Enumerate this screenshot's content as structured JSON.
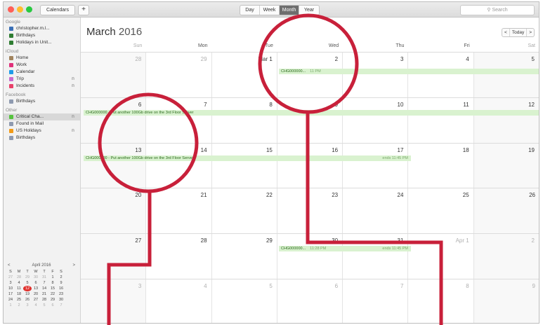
{
  "toolbar": {
    "calendars_btn": "Calendars",
    "add_btn": "+",
    "views": [
      "Day",
      "Week",
      "Month",
      "Year"
    ],
    "selected_view": "Month",
    "search_placeholder": "Search"
  },
  "sidebar": {
    "groups": [
      {
        "name": "Google",
        "items": [
          {
            "label": "christopher.m.l...",
            "color": "#3b6fb6"
          },
          {
            "label": "Birthdays",
            "color": "#2f7d32"
          },
          {
            "label": "Holidays in Unit...",
            "color": "#2f7d32"
          }
        ]
      },
      {
        "name": "iCloud",
        "items": [
          {
            "label": "Home",
            "color": "#a2845e"
          },
          {
            "label": "Work",
            "color": "#e0307a"
          },
          {
            "label": "Calendar",
            "color": "#1e9be8"
          },
          {
            "label": "Trip",
            "color": "#c86bd0"
          },
          {
            "label": "Incidents",
            "color": "#e8416a"
          }
        ]
      },
      {
        "name": "Facebook",
        "items": [
          {
            "label": "Birthdays",
            "color": "#8e9ab0"
          }
        ]
      },
      {
        "name": "Other",
        "items": [
          {
            "label": "Critical Cha...",
            "color": "#56c23e"
          },
          {
            "label": "Found in Mail",
            "color": "#8e9ab0"
          },
          {
            "label": "US Holidays",
            "color": "#f29b18"
          },
          {
            "label": "Birthdays",
            "color": "#8e9ab0"
          }
        ]
      }
    ]
  },
  "mini_cal": {
    "title": "April 2016",
    "prev": "<",
    "next": ">",
    "dow": [
      "S",
      "M",
      "T",
      "W",
      "T",
      "F",
      "S"
    ],
    "weeks": [
      [
        "27",
        "28",
        "29",
        "30",
        "31",
        "1",
        "2"
      ],
      [
        "3",
        "4",
        "5",
        "6",
        "7",
        "8",
        "9"
      ],
      [
        "10",
        "11",
        "12",
        "13",
        "14",
        "15",
        "16"
      ],
      [
        "17",
        "18",
        "19",
        "20",
        "21",
        "22",
        "23"
      ],
      [
        "24",
        "25",
        "26",
        "27",
        "28",
        "29",
        "30"
      ],
      [
        "1",
        "2",
        "3",
        "4",
        "5",
        "6",
        "7"
      ]
    ]
  },
  "main": {
    "month": "March",
    "year": "2016",
    "nav_prev": "<",
    "nav_today": "Today",
    "nav_next": ">",
    "dow": [
      "Sun",
      "Mon",
      "Tue",
      "Wed",
      "Thu",
      "Fri",
      "Sat"
    ],
    "weeks": [
      [
        "28",
        "29",
        "Mar 1",
        "2",
        "3",
        "4",
        "5"
      ],
      [
        "6",
        "7",
        "8",
        "9",
        "10",
        "11",
        "12"
      ],
      [
        "13",
        "14",
        "15",
        "16",
        "17",
        "18",
        "19"
      ],
      [
        "20",
        "21",
        "22",
        "23",
        "24",
        "25",
        "26"
      ],
      [
        "27",
        "28",
        "29",
        "30",
        "31",
        "Apr 1",
        "2"
      ],
      [
        "3",
        "4",
        "5",
        "6",
        "7",
        "8",
        "9"
      ]
    ]
  },
  "events": [
    {
      "title": "CHG000000...",
      "time": "11 PM"
    },
    {
      "title": "CHG000000 - Put another 100Gb drive on the 3rd Floor Server",
      "time": ""
    },
    {
      "title": "CHG000000 - Put another 100Gb drive on the 3rd Floor Server",
      "time": ""
    },
    {
      "title": "",
      "time": "ends 11:45 PM"
    },
    {
      "title": "CHG000000...",
      "time": "11:28 PM"
    },
    {
      "title": "",
      "time": "ends 11:45 PM"
    }
  ]
}
